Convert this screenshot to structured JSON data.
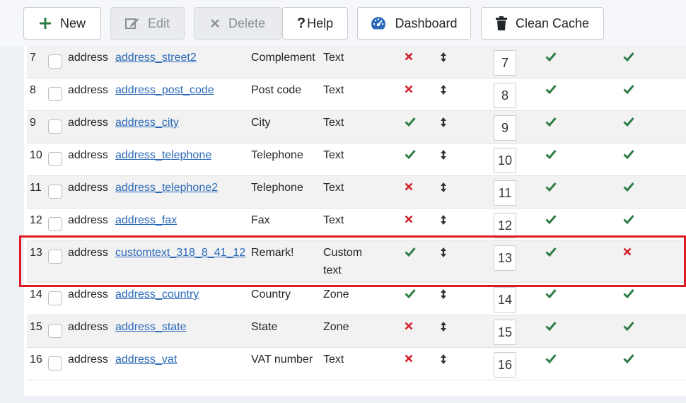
{
  "toolbar": {
    "new_label": "New",
    "edit_label": "Edit",
    "delete_label": "Delete",
    "help_label": "Help",
    "help_glyph": "?",
    "dashboard_label": "Dashboard",
    "clean_cache_label": "Clean Cache"
  },
  "colors": {
    "check": "#2e7d46",
    "cross": "#d3212d",
    "link": "#2a69b8",
    "highlight": "#e01a22"
  },
  "rows": [
    {
      "num": "7",
      "section": "address",
      "name": "address_street2",
      "title": "Complement",
      "type": "Text",
      "required": false,
      "order": "7",
      "published": true,
      "registration": true
    },
    {
      "num": "8",
      "section": "address",
      "name": "address_post_code",
      "title": "Post code",
      "type": "Text",
      "required": false,
      "order": "8",
      "published": true,
      "registration": true
    },
    {
      "num": "9",
      "section": "address",
      "name": "address_city",
      "title": "City",
      "type": "Text",
      "required": true,
      "order": "9",
      "published": true,
      "registration": true
    },
    {
      "num": "10",
      "section": "address",
      "name": "address_telephone",
      "title": "Telephone",
      "type": "Text",
      "required": true,
      "order": "10",
      "published": true,
      "registration": true
    },
    {
      "num": "11",
      "section": "address",
      "name": "address_telephone2",
      "title": "Telephone",
      "type": "Text",
      "required": false,
      "order": "11",
      "published": true,
      "registration": true
    },
    {
      "num": "12",
      "section": "address",
      "name": "address_fax",
      "title": "Fax",
      "type": "Text",
      "required": false,
      "order": "12",
      "published": true,
      "registration": true
    },
    {
      "num": "13",
      "section": "address",
      "name": "customtext_318_8_41_12",
      "title": "Remark!",
      "type": "Custom text",
      "required": true,
      "order": "13",
      "published": true,
      "registration": false
    },
    {
      "num": "14",
      "section": "address",
      "name": "address_country",
      "title": "Country",
      "type": "Zone",
      "required": true,
      "order": "14",
      "published": true,
      "registration": true
    },
    {
      "num": "15",
      "section": "address",
      "name": "address_state",
      "title": "State",
      "type": "Zone",
      "required": false,
      "order": "15",
      "published": true,
      "registration": true
    },
    {
      "num": "16",
      "section": "address",
      "name": "address_vat",
      "title": "VAT number",
      "type": "Text",
      "required": false,
      "order": "16",
      "published": true,
      "registration": true
    }
  ]
}
